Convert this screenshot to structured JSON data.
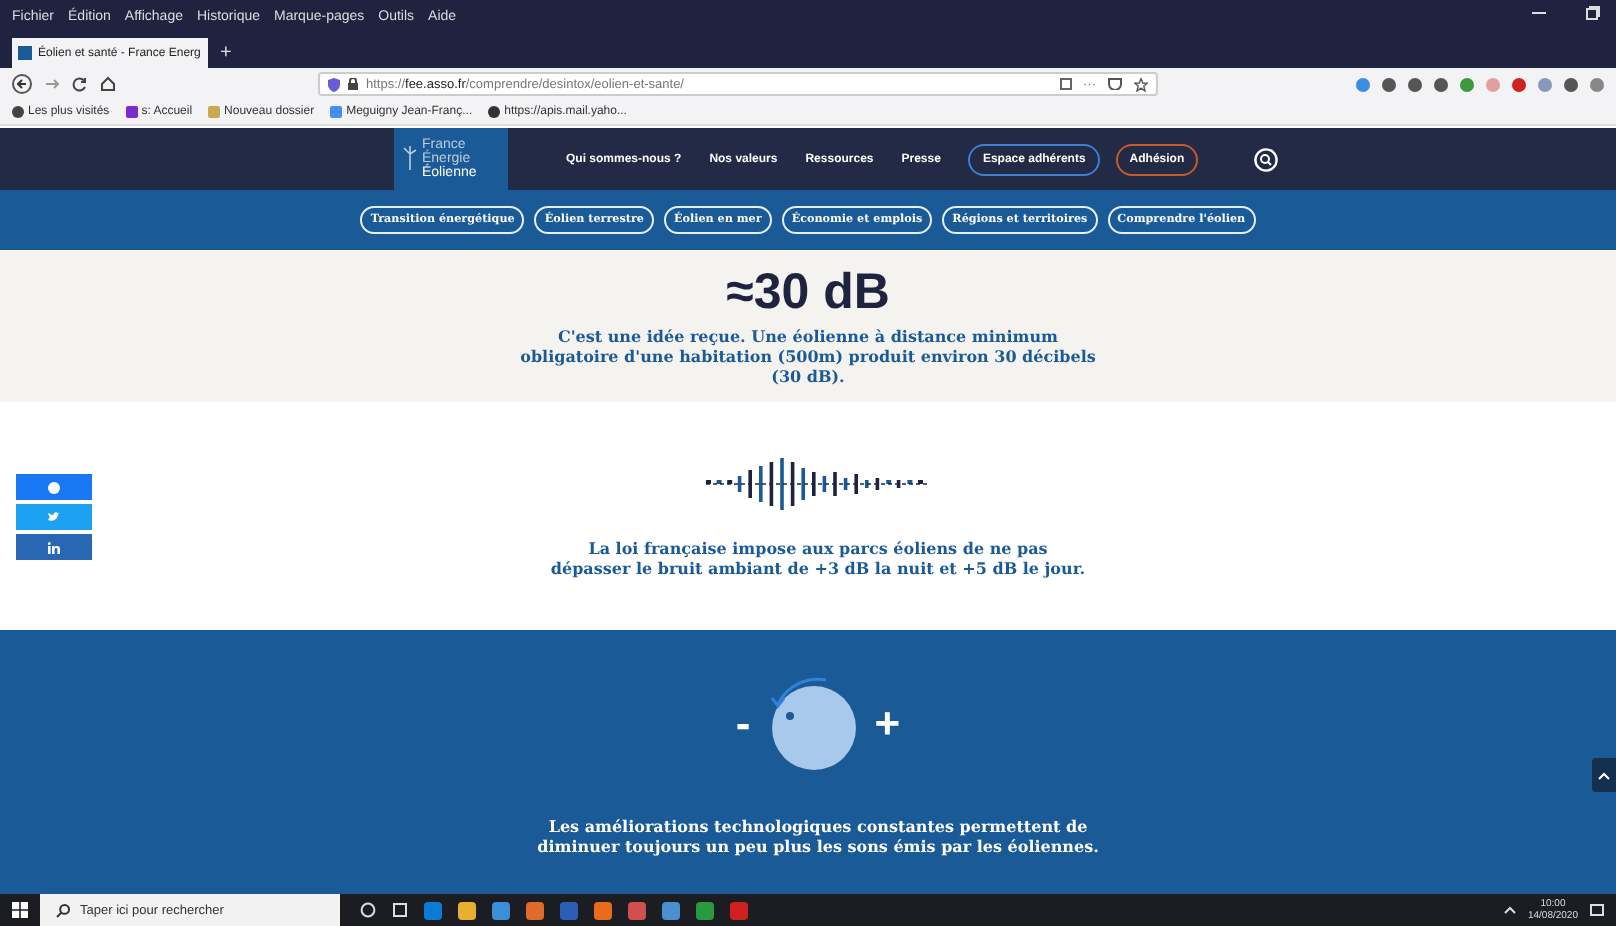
{
  "menu_bar": [
    "Fichier",
    "Édition",
    "Affichage",
    "Historique",
    "Marque-pages",
    "Outils",
    "Aide"
  ],
  "tabs": [
    {
      "title": "Éolien et santé - France Energ",
      "selected": true
    }
  ],
  "new_tab": "+",
  "address": {
    "prefix": "https://",
    "domain": "fee.asso.fr",
    "path": "/comprendre/desintox/eolien-et-sante/"
  },
  "page_actions": "···",
  "bookmarks": [
    "Les plus visités",
    "s: Accueil",
    "Nouveau dossier",
    "Meguigny Jean-Franç...",
    "https://apis.mail.yaho..."
  ],
  "site_header": {
    "logo": [
      "France",
      "Énergie",
      "Éolienne"
    ],
    "nav": [
      "Qui sommes-nous ?",
      "Nos valeurs",
      "Ressources",
      "Presse"
    ],
    "members_button": "Espace adhérents",
    "join_button": "Adhésion"
  },
  "topics": [
    "Transition énergétique",
    "Éolien terrestre",
    "Éolien en mer",
    "Économie et emplois",
    "Régions et territoires",
    "Comprendre l'éolien"
  ],
  "sections": [
    {
      "kind": "stat",
      "headline": "≈30 dB",
      "text": "C'est une idée reçue. Une éolienne à distance minimum obligatoire d'une habitation (500m) produit environ 30 décibels (30 dB)."
    },
    {
      "kind": "wave",
      "text": "La loi française impose aux parcs éoliens de ne pas dépasser le bruit ambiant de +3 dB la nuit et +5 dB le jour."
    },
    {
      "kind": "knob",
      "minus": "-",
      "plus": "+",
      "text": "Les améliorations technologiques constantes permettent de diminuer toujours un peu plus les sons émis par les éoliennes."
    }
  ],
  "taskbar": {
    "search_placeholder": "Taper ici pour rechercher",
    "time": "10:00",
    "date": "14/08/2020"
  }
}
